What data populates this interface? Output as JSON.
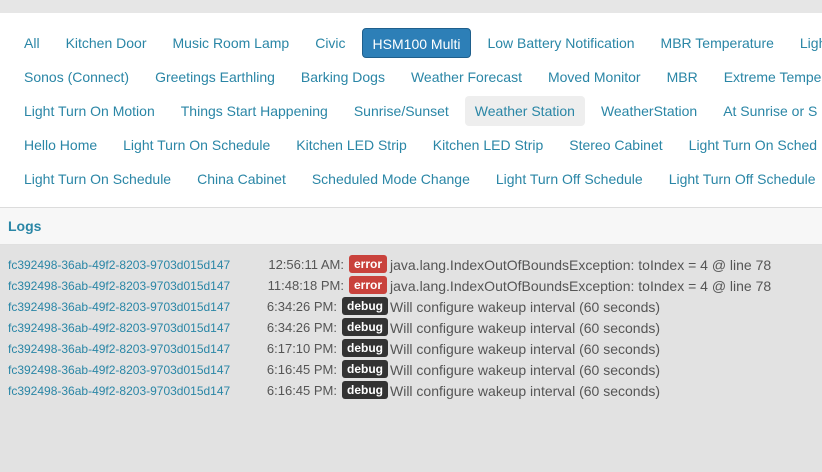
{
  "filters": {
    "rows": [
      [
        "All",
        "Kitchen Door",
        "Music Room Lamp",
        "Civic",
        "HSM100 Multi",
        "Low Battery Notification",
        "MBR Temperature",
        "Light"
      ],
      [
        "Sonos (Connect)",
        "Greetings Earthling",
        "Barking Dogs",
        "Weather Forecast",
        "Moved Monitor",
        "MBR",
        "Extreme Tempe"
      ],
      [
        "Light Turn On Motion",
        "Things Start Happening",
        "Sunrise/Sunset",
        "Weather Station",
        "WeatherStation",
        "At Sunrise or S"
      ],
      [
        "Hello Home",
        "Light Turn On Schedule",
        "Kitchen LED Strip",
        "Kitchen LED Strip",
        "Stereo Cabinet",
        "Light Turn On Sched"
      ],
      [
        "Light Turn On Schedule",
        "China Cabinet",
        "Scheduled Mode Change",
        "Light Turn Off Schedule",
        "Light Turn Off Schedule"
      ]
    ],
    "active": "HSM100 Multi",
    "hovered": "Weather Station"
  },
  "logs": {
    "title": "Logs",
    "entries": [
      {
        "source": "fc392498-36ab-49f2-8203-9703d015d147",
        "time": "12:56:11 AM:",
        "level": "error",
        "message": "java.lang.IndexOutOfBoundsException: toIndex = 4 @ line 78"
      },
      {
        "source": "fc392498-36ab-49f2-8203-9703d015d147",
        "time": "11:48:18 PM:",
        "level": "error",
        "message": "java.lang.IndexOutOfBoundsException: toIndex = 4 @ line 78"
      },
      {
        "source": "fc392498-36ab-49f2-8203-9703d015d147",
        "time": "6:34:26 PM:",
        "level": "debug",
        "message": "Will configure wakeup interval (60 seconds)"
      },
      {
        "source": "fc392498-36ab-49f2-8203-9703d015d147",
        "time": "6:34:26 PM:",
        "level": "debug",
        "message": "Will configure wakeup interval (60 seconds)"
      },
      {
        "source": "fc392498-36ab-49f2-8203-9703d015d147",
        "time": "6:17:10 PM:",
        "level": "debug",
        "message": "Will configure wakeup interval (60 seconds)"
      },
      {
        "source": "fc392498-36ab-49f2-8203-9703d015d147",
        "time": "6:16:45 PM:",
        "level": "debug",
        "message": "Will configure wakeup interval (60 seconds)"
      },
      {
        "source": "fc392498-36ab-49f2-8203-9703d015d147",
        "time": "6:16:45 PM:",
        "level": "debug",
        "message": "Will configure wakeup interval (60 seconds)"
      }
    ]
  },
  "colors": {
    "accent": "#2a86a6",
    "active_pill": "#2d7fb7",
    "error_badge": "#c9423c",
    "debug_badge": "#333333"
  }
}
